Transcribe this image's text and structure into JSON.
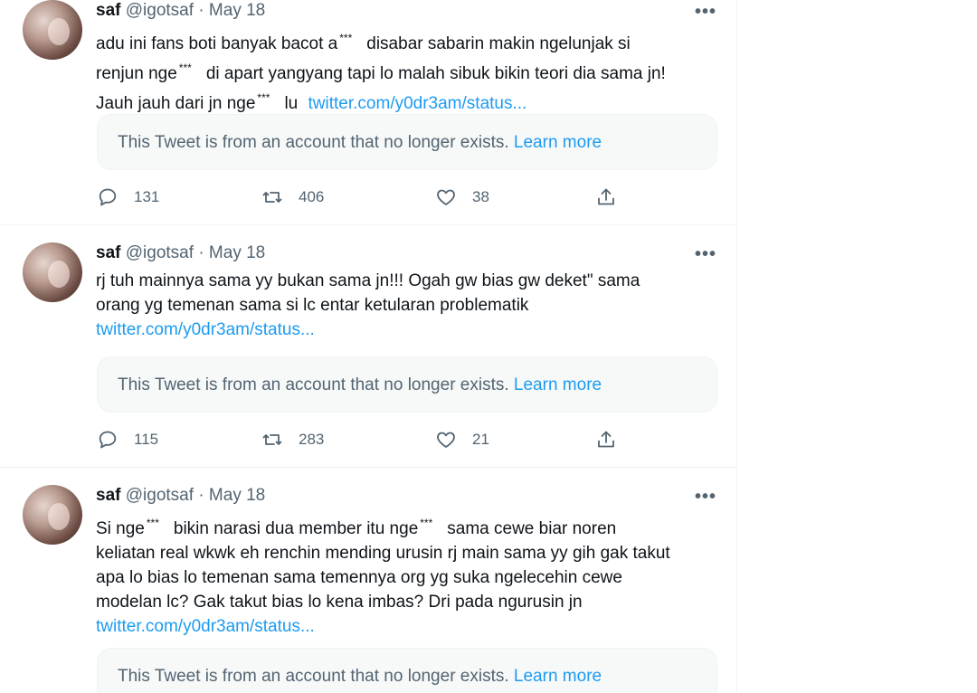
{
  "tweets": [
    {
      "name": "saf",
      "handle": "@igotsaf",
      "separator": "·",
      "date": "May 18",
      "more": "•••",
      "lines": [
        {
          "a": "adu ini fans boti banyak bacot a",
          "censor": "***",
          "b": "disabar sabarin makin ngelunjak si"
        },
        {
          "a": "renjun nge",
          "censor": "***",
          "b": "di apart yangyang tapi lo malah sibuk bikin teori dia sama jn!"
        },
        {
          "a": "Jauh jauh dari jn nge",
          "censor": "***",
          "b": "lu"
        }
      ],
      "link": "twitter.com/y0dr3am/status...",
      "quote_text": "This Tweet is from an account that no longer exists.",
      "quote_link": "Learn more",
      "replies": "131",
      "retweets": "406",
      "likes": "38"
    },
    {
      "name": "saf",
      "handle": "@igotsaf",
      "separator": "·",
      "date": "May 18",
      "more": "•••",
      "lines": [
        "rj tuh mainnya sama yy bukan sama jn!!! Ogah gw bias gw deket\" sama",
        "orang yg temenan sama si lc entar ketularan problematik"
      ],
      "link": "twitter.com/y0dr3am/status...",
      "quote_text": "This Tweet is from an account that no longer exists.",
      "quote_link": "Learn more",
      "replies": "115",
      "retweets": "283",
      "likes": "21"
    },
    {
      "name": "saf",
      "handle": "@igotsaf",
      "separator": "·",
      "date": "May 18",
      "more": "•••",
      "lines": [
        {
          "a": "Si nge",
          "censor": "***",
          "b": "bikin narasi dua member itu nge",
          "censor2": "***",
          "c": "sama cewe biar noren"
        },
        "keliatan real wkwk eh renchin mending urusin rj main sama yy gih gak takut",
        "apa lo bias lo temenan sama temennya org yg suka ngelecehin cewe",
        "modelan lc? Gak takut bias lo kena imbas? Dri pada ngurusin jn"
      ],
      "link": "twitter.com/y0dr3am/status...",
      "quote_text": "This Tweet is from an account that no longer exists.",
      "quote_link": "Learn more"
    }
  ],
  "icons": {
    "reply": "reply-icon",
    "retweet": "retweet-icon",
    "like": "heart-icon",
    "share": "share-icon",
    "more": "more-icon"
  },
  "colors": {
    "link": "#1d9bf0",
    "muted": "#536471",
    "text": "#0f1419"
  }
}
